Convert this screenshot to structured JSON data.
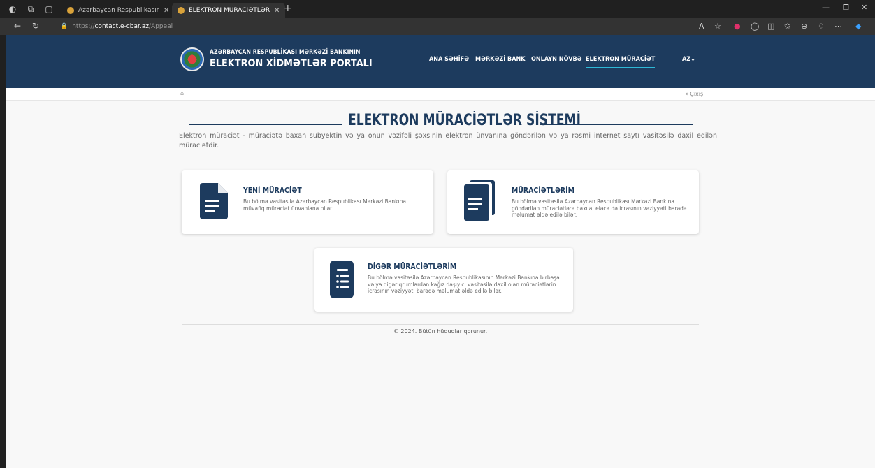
{
  "browser": {
    "tabs": [
      {
        "title": "Azərbaycan Respublikasının Mərkəzi Bankı",
        "active": false
      },
      {
        "title": "ELEKTRON MÜRACİƏTLƏR SİSTEMİ",
        "active": true
      }
    ],
    "url": {
      "scheme": "https://",
      "host": "contact.e-cbar.az",
      "path": "/Appeal"
    }
  },
  "header": {
    "brand_top": "AZƏRBAYCAN RESPUBLİKASI MƏRKƏZİ BANKININ",
    "brand_main": "ELEKTRON XİDMƏTLƏR PORTALI",
    "menu": [
      {
        "label": "ANA SƏHİFƏ"
      },
      {
        "label": "MƏRKƏZİ BANK"
      },
      {
        "label": "ONLAYN NÖVBƏ"
      },
      {
        "label": "ELEKTRON MÜRACİƏT",
        "active": true
      }
    ],
    "language": "AZ⌄"
  },
  "subbar": {
    "logout_label": "Çıxış"
  },
  "main": {
    "title": "ELEKTRON MÜRACİƏTLƏR SİSTEMİ",
    "intro": "Elektron müraciət - müraciətə baxan subyektin və ya onun vəzifəli şəxsinin elektron ünvanına göndərilən və ya rəsmi internet saytı vasitəsilə daxil edilən müraciətdir.",
    "cards": [
      {
        "title": "YENİ MÜRACİƏT",
        "description": "Bu bölmə vasitəsilə Azərbaycan Respublikası Mərkəzi Bankına müvafiq müraciət ünvanlana bilər.",
        "icon": "document-icon"
      },
      {
        "title": "MÜRACİƏTLƏRİM",
        "description": "Bu bölmə vasitəsilə Azərbaycan Respublikası Mərkəzi Bankına göndərilən müraciətlərə baxıla, eləcə də icrasının vəziyyəti barədə məlumat əldə edilə bilər.",
        "icon": "documents-icon"
      },
      {
        "title": "DİGƏR MÜRACİƏTLƏRİM",
        "description": "Bu bölmə vasitəsilə Azərbaycan Respublikasının Mərkəzi Bankına birbaşa və ya digər qrumlardan kağız daşıyıcı vasitəsilə daxil olan müraciətlərin icrasının vəziyyəti barədə məlumat əldə edilə bilər.",
        "icon": "list-icon"
      }
    ]
  },
  "footer": {
    "copyright": "© 2024. Bütün hüquqlar qorunur."
  },
  "colors": {
    "brand_navy": "#1d3b5e",
    "accent_cyan": "#2eb8d6",
    "page_bg": "#f8f8f8"
  }
}
